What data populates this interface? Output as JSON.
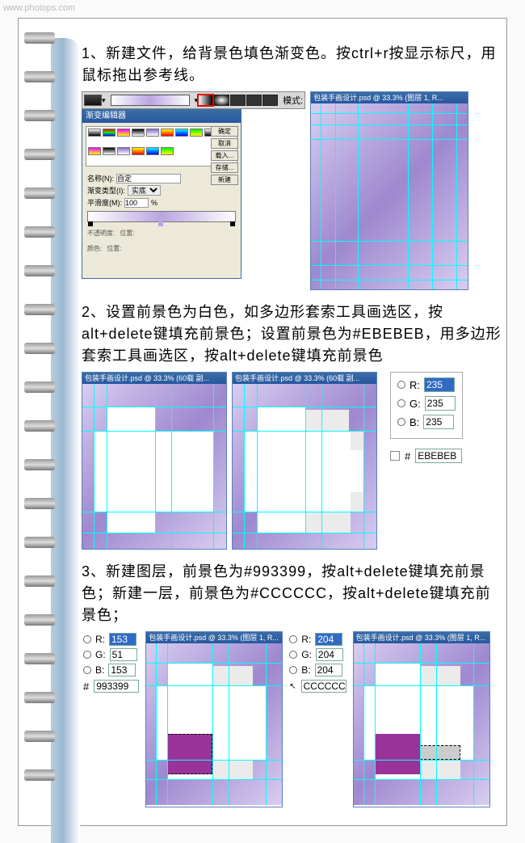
{
  "watermark": "www.photops.com",
  "steps": {
    "s1": "1、新建文件，给背景色填色渐变色。按ctrl+r按显示标尺，用鼠标拖出参考线。",
    "s2": "2、设置前景色为白色，如多边形套索工具画选区，按alt+delete键填充前景色；设置前景色为#EBEBEB，用多边形套索工具画选区，按alt+delete键填充前景色",
    "s3": "3、新建图层，前景色为#993399，按alt+delete键填充前景色；新建一层，前景色为#CCCCCC，按alt+delete键填充前景色；"
  },
  "gradient_bar": {
    "mode_label": "模式:"
  },
  "gradient_dialog": {
    "title": "渐变编辑器",
    "name_label": "名称(N):",
    "name_value": "自定",
    "type_label": "渐变类型(I):",
    "type_value": "实底",
    "smooth_label": "平滑度(M):",
    "smooth_value": "100",
    "percent": "%",
    "btns": {
      "ok": "确定",
      "cancel": "取消",
      "load": "载入...",
      "save": "存储...",
      "new": "新建"
    },
    "stop_labels": {
      "opacity": "不透明度:",
      "position": "位置:",
      "color": "颜色:"
    }
  },
  "ps_window_title": "包装手画设计.psd @ 33.3% (图层 1, R...",
  "ps_window_title2": "包装手画设计.psd @ 33.3% (60载 副...",
  "rgb_step2": {
    "r_label": "R:",
    "r": "235",
    "g_label": "G:",
    "g": "235",
    "b_label": "B:",
    "b": "235",
    "hex_sym": "#",
    "hex": "EBEBEB"
  },
  "rgb_step3a": {
    "r_label": "R:",
    "r": "153",
    "g_label": "G:",
    "g": "51",
    "b_label": "B:",
    "b": "153",
    "hex_sym": "#",
    "hex": "993399"
  },
  "rgb_step3b": {
    "r_label": "R:",
    "r": "204",
    "g_label": "G:",
    "g": "204",
    "b_label": "B:",
    "b": "204",
    "hex_sym": "#",
    "hex": "CCCCCC"
  }
}
